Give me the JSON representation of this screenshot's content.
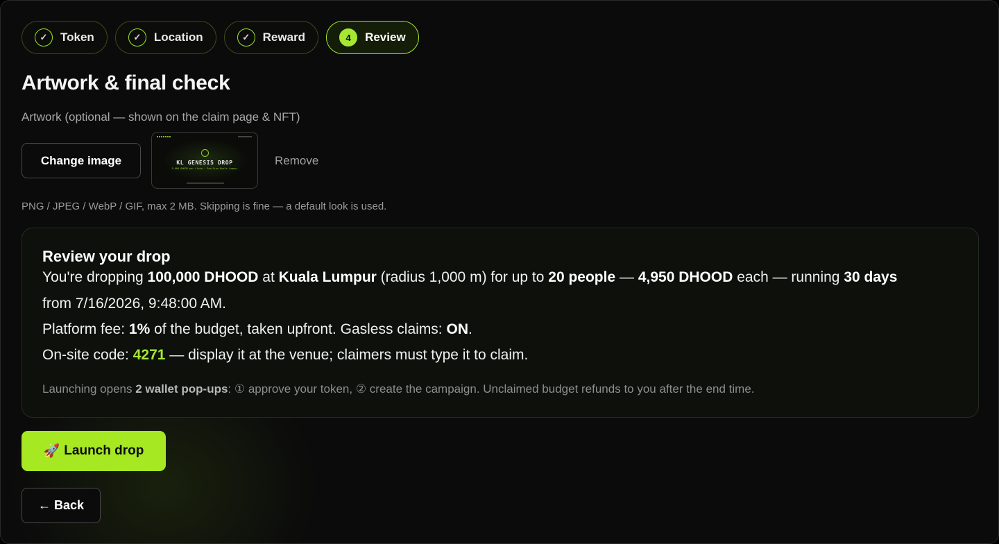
{
  "steps": [
    {
      "label": "Token",
      "badge": "✓",
      "state": "done"
    },
    {
      "label": "Location",
      "badge": "✓",
      "state": "done"
    },
    {
      "label": "Reward",
      "badge": "✓",
      "state": "done"
    },
    {
      "label": "Review",
      "badge": "4",
      "state": "active"
    }
  ],
  "page_title": "Artwork & final check",
  "artwork": {
    "label": "Artwork (optional — shown on the claim page & NFT)",
    "change_button": "Change image",
    "remove_link": "Remove",
    "preview_title": "KL GENESIS DROP",
    "preview_subtitle": "5,000 DHOOD per claim · Pavilion Kuala Lumpur",
    "hint": "PNG / JPEG / WebP / GIF, max 2 MB. Skipping is fine — a default look is used."
  },
  "review": {
    "title": "Review your drop",
    "l1_a": "You're dropping ",
    "amount": "100,000 DHOOD",
    "l1_b": " at ",
    "location": "Kuala Lumpur",
    "l1_c": " (radius 1,000 m) for up to ",
    "people": "20 people",
    "l1_d": " — ",
    "each_amount": "4,950 DHOOD",
    "l1_e": " each — running ",
    "duration": "30 days",
    "l2": "from 7/16/2026, 9:48:00 AM.",
    "l3_a": "Platform fee: ",
    "fee": "1%",
    "l3_b": " of the budget, taken upfront. Gasless claims: ",
    "gasless": "ON",
    "l3_c": ".",
    "l4_a": "On-site code: ",
    "code": "4271",
    "l4_b": " — display it at the venue; claimers must type it to claim.",
    "note_a": "Launching opens ",
    "note_bold": "2 wallet pop-ups",
    "note_b": ": ① approve your token, ② create the campaign. Unclaimed budget refunds to you after the end time."
  },
  "actions": {
    "launch_icon": "🚀",
    "launch_label": "Launch drop",
    "back_label": "← Back"
  },
  "colors": {
    "accent": "#a6e831",
    "background": "#0b0b0b"
  }
}
